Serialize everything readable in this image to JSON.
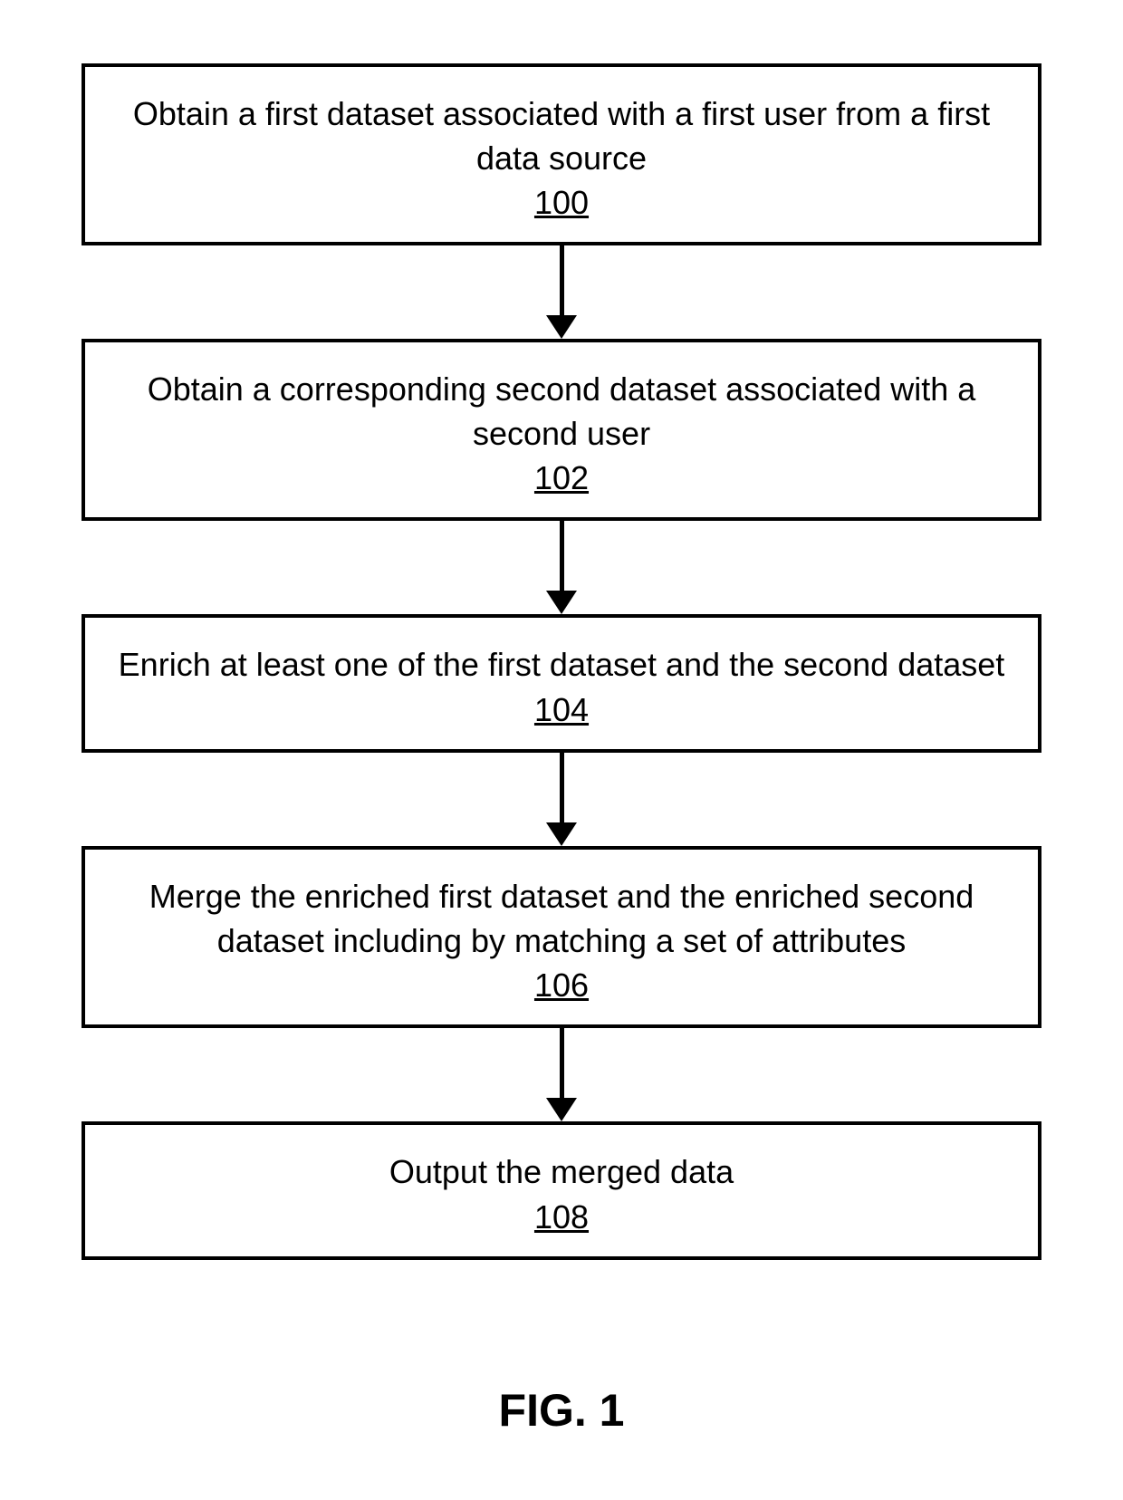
{
  "flowchart": {
    "steps": [
      {
        "text": "Obtain a first dataset associated with a first user from a first data source",
        "ref": "100"
      },
      {
        "text": "Obtain a corresponding second dataset associated with a second user",
        "ref": "102"
      },
      {
        "text": "Enrich at least one of the first dataset and the second dataset",
        "ref": "104"
      },
      {
        "text": "Merge the enriched first dataset and the enriched second dataset including by matching a set of attributes",
        "ref": "106"
      },
      {
        "text": "Output the merged data",
        "ref": "108"
      }
    ]
  },
  "figure_label": "FIG. 1"
}
